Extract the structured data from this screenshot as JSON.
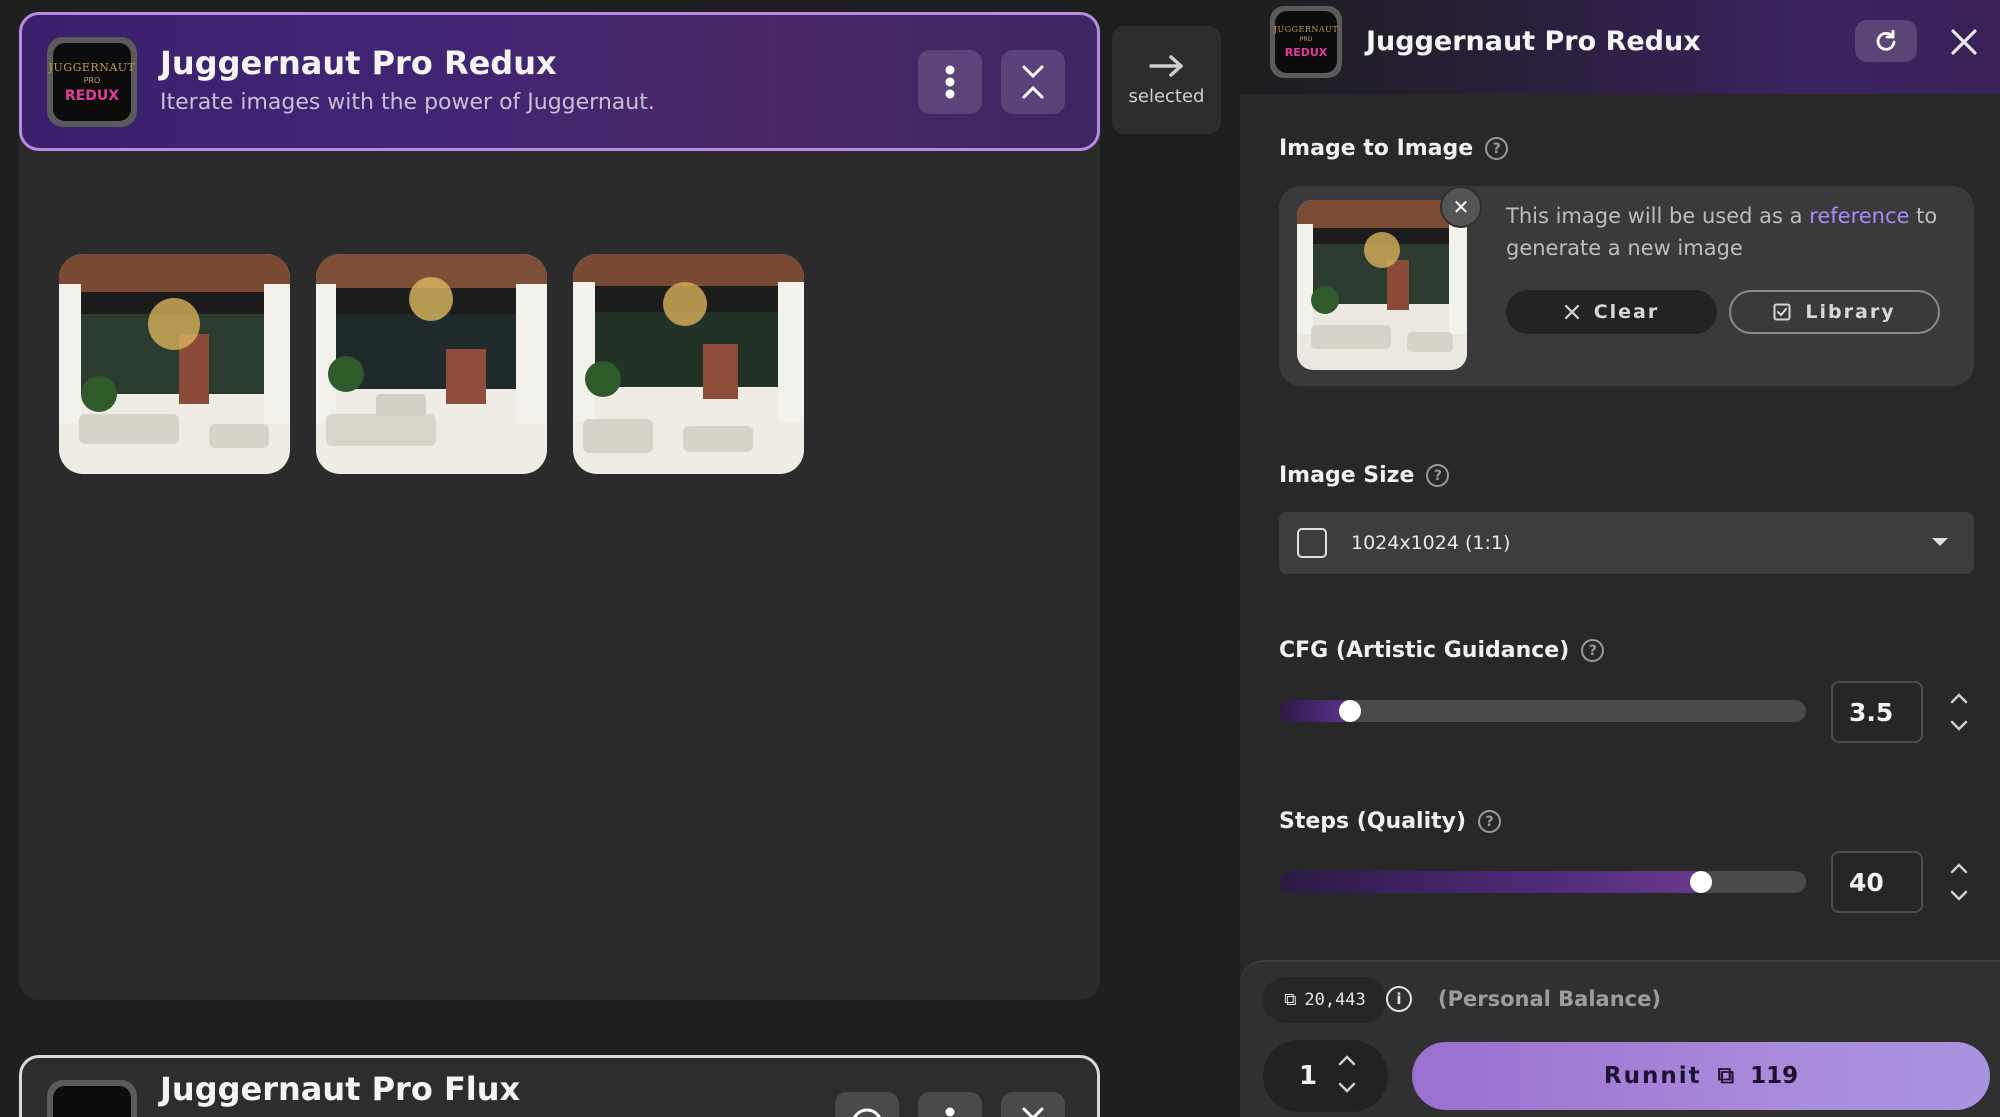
{
  "left_card": {
    "title": "Juggernaut Pro Redux",
    "subtitle": "Iterate images with the power of Juggernaut.",
    "logo": {
      "line1": "JUGGERNAUT",
      "line2": "PRO",
      "line3": "REDUX"
    },
    "menu_icon": "vertical-dots-icon",
    "collapse_icon": "collapse-chevrons-icon",
    "thumbnails": [
      {
        "name": "living-room-thumbnail-1"
      },
      {
        "name": "living-room-thumbnail-2"
      },
      {
        "name": "living-room-thumbnail-3"
      }
    ]
  },
  "side_action": {
    "label": "selected",
    "icon": "arrow-right-icon"
  },
  "second_card": {
    "title": "Juggernaut Pro Flux"
  },
  "panel": {
    "title": "Juggernaut Pro Redux",
    "image_to_image": {
      "label": "Image to Image",
      "text_before": "This image will be used as a ",
      "text_link": "reference",
      "text_after": " to generate a new image",
      "clear_label": "Clear",
      "library_label": "Library"
    },
    "image_size": {
      "label": "Image Size",
      "value": "1024x1024 (1:1)"
    },
    "cfg": {
      "label": "CFG (Artistic Guidance)",
      "value": "3.5",
      "fill_fraction": 0.135
    },
    "steps": {
      "label": "Steps (Quality)",
      "value": "40",
      "fill_fraction": 0.8
    }
  },
  "footer": {
    "balance": "20,443",
    "balance_label": "(Personal Balance)",
    "quantity": "1",
    "run_label": "Runnit",
    "run_cost": "119"
  },
  "colors": {
    "accent": "#b58ce0",
    "link": "#a78bfa",
    "run_button": "#a989db"
  }
}
